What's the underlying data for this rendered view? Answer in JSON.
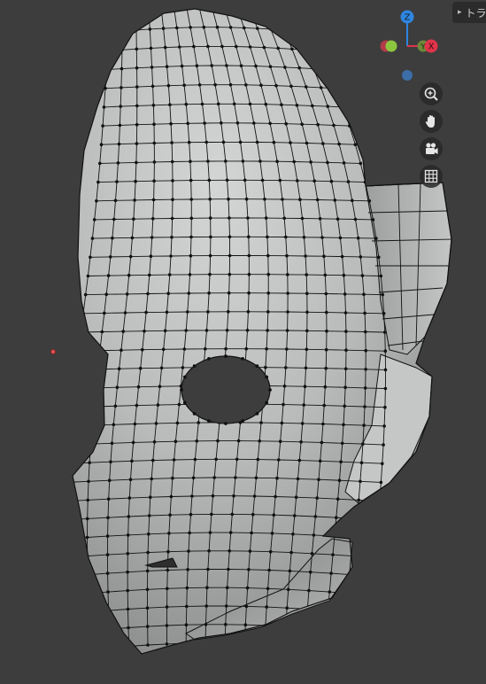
{
  "sidebar_tab": {
    "label": "トラ",
    "arrow": "▸"
  },
  "gizmo": {
    "z_label": "Z",
    "y_label": "Y",
    "x_label": "X",
    "colors": {
      "z": "#2f86e0",
      "y": "#8cc63f",
      "x": "#e0344a",
      "neg_y": "#8cc63f",
      "neg_x": "#b23a4a",
      "neg_z": "#3c6ea8"
    }
  },
  "nav_buttons": [
    {
      "name": "zoom-icon"
    },
    {
      "name": "hand-pan-icon"
    },
    {
      "name": "camera-view-icon"
    },
    {
      "name": "ortho-grid-icon"
    }
  ],
  "viewport": {
    "background": "#3d3d3d",
    "mesh_color": "#cfd0d0",
    "wire_color": "#111111",
    "origin_color": "#e05050"
  }
}
